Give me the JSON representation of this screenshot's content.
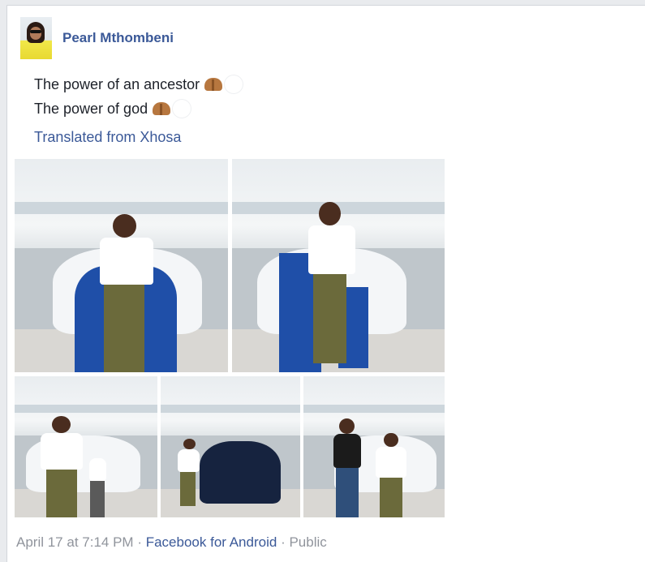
{
  "post": {
    "author": "Pearl Mthombeni",
    "text_line_1": "The power of an ancestor",
    "text_line_2": "The power of god",
    "emoji_1": "raised-hands-emoji",
    "emoji_2": "white-heart-emoji",
    "translated_label": "Translated from Xhosa",
    "photos": [
      "photo-1",
      "photo-2",
      "photo-3",
      "photo-4",
      "photo-5"
    ]
  },
  "meta": {
    "date": "April 17 at 7:14 PM",
    "separator": "·",
    "app": "Facebook for Android",
    "privacy": "Public"
  },
  "colors": {
    "link": "#3b5998",
    "text": "#1d2129",
    "meta": "#90949c",
    "car_cover": "#1f4fa8"
  }
}
